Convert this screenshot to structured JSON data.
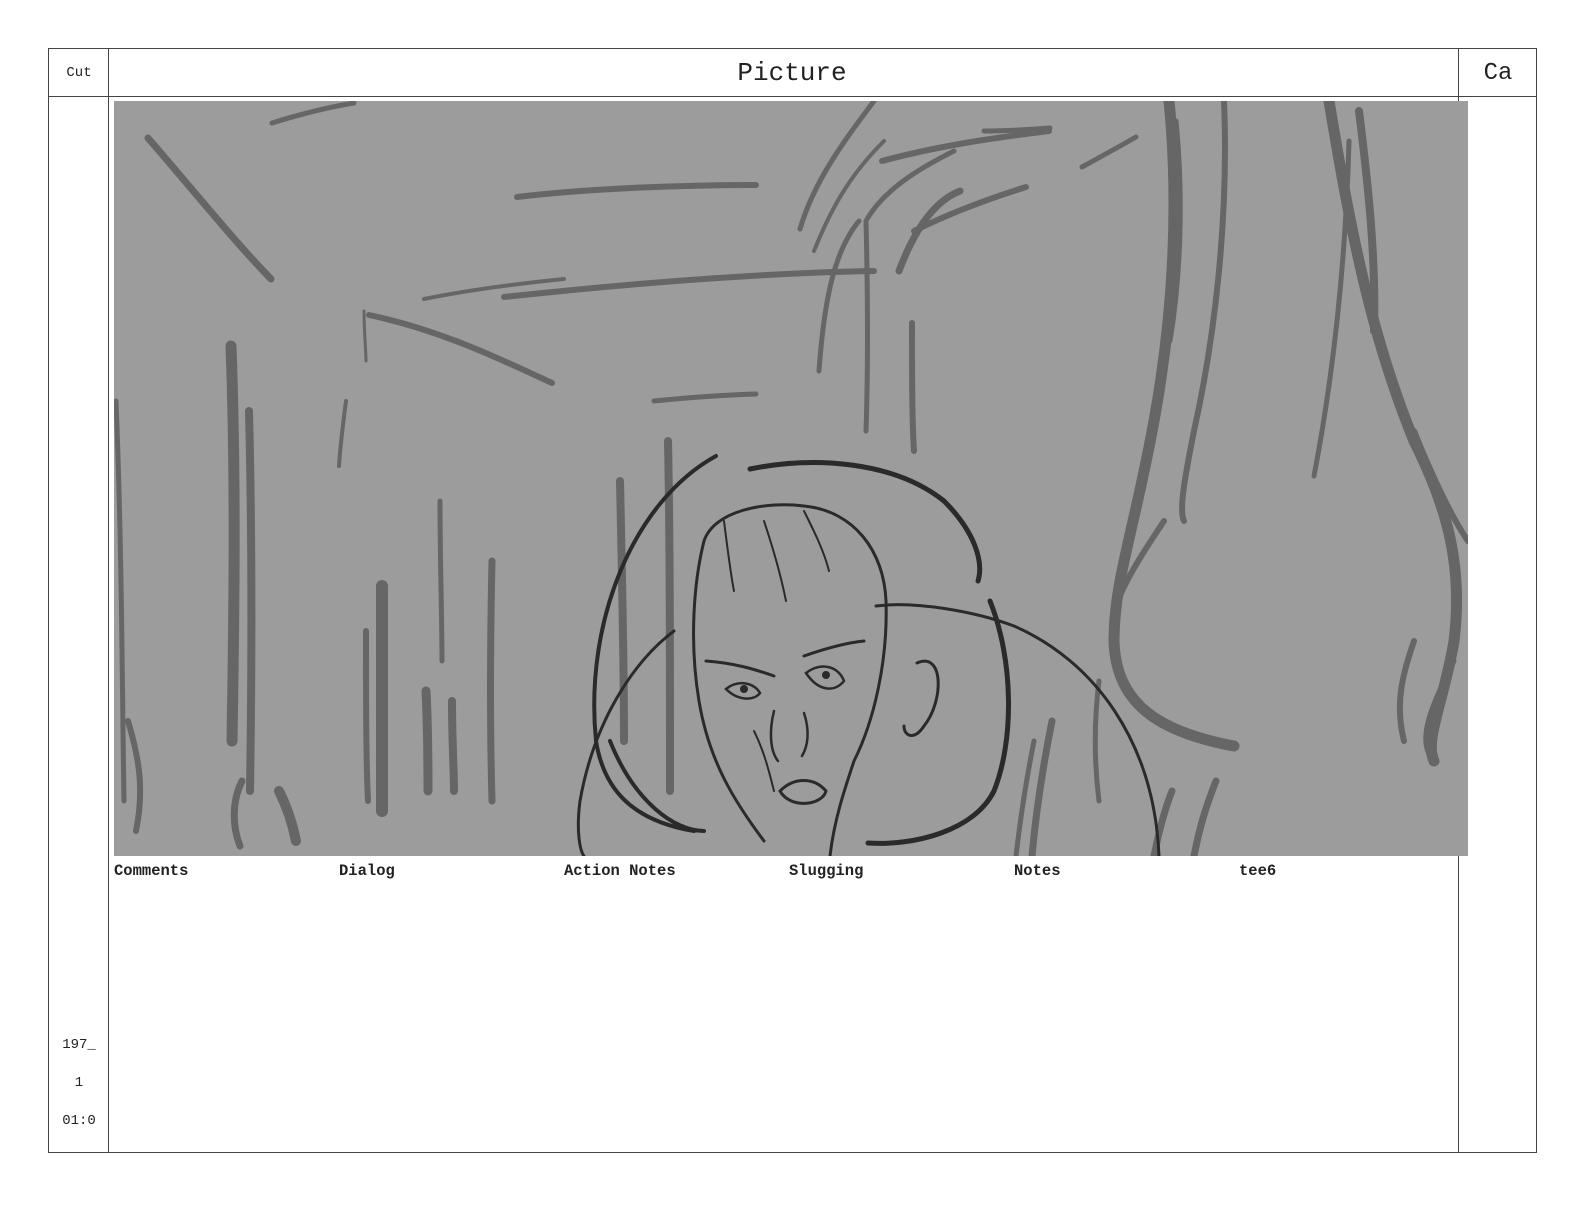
{
  "header": {
    "cut_label": "Cut",
    "picture_label": "Picture",
    "camera_label": "Ca"
  },
  "sidebar": {
    "scene": "197_",
    "panel": "1",
    "duration": "01:0"
  },
  "fields": [
    {
      "label": "Comments"
    },
    {
      "label": "Dialog"
    },
    {
      "label": "Action Notes"
    },
    {
      "label": "Slugging"
    },
    {
      "label": "Notes"
    },
    {
      "label": "tee6"
    }
  ],
  "colors": {
    "panel_background": "#9c9c9c",
    "sketch_mid": "#666666",
    "sketch_dark": "#2a2a2a",
    "border": "#444444"
  }
}
